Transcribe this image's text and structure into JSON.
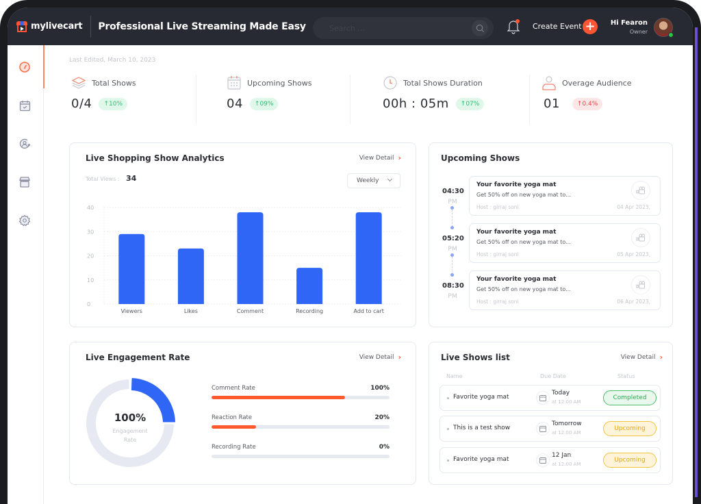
{
  "app": {
    "brand": "mylivecart",
    "title": "Professional Live Streaming Made Easy",
    "search_placeholder": "Search ...",
    "create_event_label": "Create Event",
    "user": {
      "greeting": "Hi Fearon",
      "role": "Owner"
    }
  },
  "sidebar": {
    "items": [
      {
        "id": "dashboard",
        "icon": "dashboard-gauge-icon",
        "active": true
      },
      {
        "id": "calendar",
        "icon": "calendar-check-icon",
        "active": false
      },
      {
        "id": "users",
        "icon": "user-refresh-icon",
        "active": false
      },
      {
        "id": "store",
        "icon": "store-icon",
        "active": false
      },
      {
        "id": "settings",
        "icon": "gear-icon",
        "active": false
      }
    ]
  },
  "last_edited": "Last Edited, March 10, 2023",
  "stats": [
    {
      "label": "Total Shows",
      "value": "0/4",
      "change": "10%",
      "trend": "up",
      "icon": "layers-icon"
    },
    {
      "label": "Upcoming Shows",
      "value": "04",
      "change": "09%",
      "trend": "up",
      "icon": "calendar-grid-icon"
    },
    {
      "label": "Total Shows Duration",
      "value": "00h : 05m",
      "change": "07%",
      "trend": "up",
      "icon": "clock-icon"
    },
    {
      "label": "Overage Audience",
      "value": "01",
      "change": "0.4%",
      "trend": "down",
      "icon": "user-icon"
    }
  ],
  "analytics": {
    "title": "Live Shopping Show Analytics",
    "view_detail": "View Detail",
    "total_views_label": "Total Views :",
    "total_views_value": "34",
    "period": "Weekly"
  },
  "chart_data": {
    "type": "bar",
    "title": "Live Shopping Show Analytics",
    "categories": [
      "Viewers",
      "Likes",
      "Comment",
      "Recording",
      "Add to cart"
    ],
    "values": [
      29,
      23,
      38,
      15,
      38
    ],
    "xlabel": "",
    "ylabel": "",
    "ylim": [
      0,
      40
    ],
    "yticks": [
      0,
      10,
      20,
      30,
      40
    ],
    "grid": true,
    "color": "#2f66f5"
  },
  "upcoming": {
    "title": "Upcoming Shows",
    "items": [
      {
        "time": "04:30",
        "ampm": "PM",
        "title": "Your favorite yoga mat",
        "desc": "Get 50% off on new yoga mat to...",
        "host": "Host : girraj soni",
        "date": "04 Apr 2023,"
      },
      {
        "time": "05:20",
        "ampm": "PM",
        "title": "Your favorite yoga mat",
        "desc": "Get 50% off on new yoga mat to...",
        "host": "Host : girraj soni",
        "date": "05 Apr 2023,"
      },
      {
        "time": "08:30",
        "ampm": "PM",
        "title": "Your favorite yoga mat",
        "desc": "Get 50% off on new yoga mat to...",
        "host": "Host : girraj soni",
        "date": "06 Apr 2023,"
      }
    ]
  },
  "engagement": {
    "title": "Live Engagement Rate",
    "view_detail": "View Detail",
    "center_value": "100%",
    "center_label_1": "Engagement",
    "center_label_2": "Rate",
    "donut_fraction": 0.25,
    "rates": [
      {
        "label": "Comment Rate",
        "value": "100%",
        "fill": 0.75
      },
      {
        "label": "Reaction Rate",
        "value": "20%",
        "fill": 0.25
      },
      {
        "label": "Recording Rate",
        "value": "0%",
        "fill": 0
      }
    ]
  },
  "live_shows": {
    "title": "Live Shows list",
    "view_detail": "View Detail",
    "columns": [
      "Name",
      "Due Date",
      "Status"
    ],
    "rows": [
      {
        "name": "Favorite yoga mat",
        "due": "Today",
        "due_time": "at 12:00 AM",
        "status": "Completed"
      },
      {
        "name": "This is  a test show",
        "due": "Tomorrow",
        "due_time": "at 12:00 AM",
        "status": "Upcoming"
      },
      {
        "name": "Favorite yoga mat",
        "due": "12 Jan",
        "due_time": "at 12:00 AM",
        "status": "Upcoming"
      }
    ]
  },
  "colors": {
    "accent": "#ff5533",
    "primary_blue": "#2f66f5",
    "topbar": "#272a33",
    "success": "#34a853",
    "warning": "#e0a521",
    "danger": "#ef4444"
  }
}
